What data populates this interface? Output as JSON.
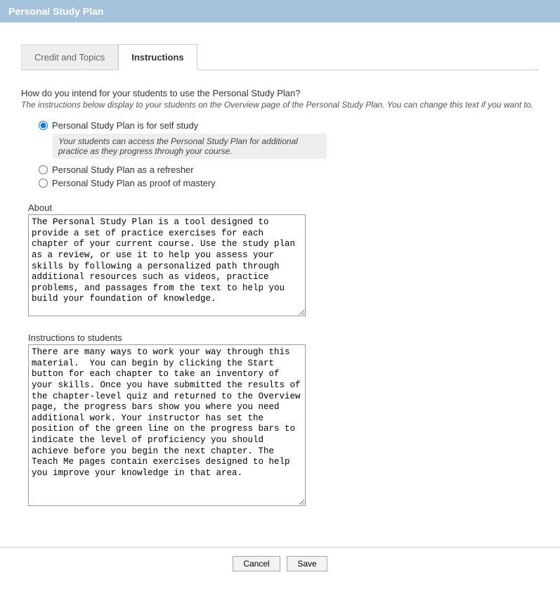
{
  "header": {
    "title": "Personal Study Plan"
  },
  "tabs": [
    {
      "label": "Credit and Topics",
      "active": false
    },
    {
      "label": "Instructions",
      "active": true
    }
  ],
  "question": "How do you intend for your students to use the Personal Study Plan?",
  "helper": "The instructions below display to your students on the Overview page of the Personal Study Plan. You can change this text if you want to.",
  "options": {
    "selfstudy": {
      "label": "Personal Study Plan is for self study",
      "desc": "Your students can access the Personal Study Plan for additional practice as they progress through your course."
    },
    "refresher": {
      "label": "Personal Study Plan as a refresher"
    },
    "mastery": {
      "label": "Personal Study Plan as proof of mastery"
    }
  },
  "about": {
    "label": "About",
    "value": "The Personal Study Plan is a tool designed to provide a set of practice exercises for each chapter of your current course. Use the study plan as a review, or use it to help you assess your skills by following a personalized path through additional resources such as videos, practice problems, and passages from the text to help you build your foundation of knowledge."
  },
  "instructions": {
    "label": "Instructions to students",
    "value": "There are many ways to work your way through this material.  You can begin by clicking the Start button for each chapter to take an inventory of your skills. Once you have submitted the results of the chapter-level quiz and returned to the Overview page, the progress bars show you where you need additional work. Your instructor has set the position of the green line on the progress bars to indicate the level of proficiency you should achieve before you begin the next chapter. The Teach Me pages contain exercises designed to help you improve your knowledge in that area."
  },
  "buttons": {
    "cancel": "Cancel",
    "save": "Save"
  }
}
